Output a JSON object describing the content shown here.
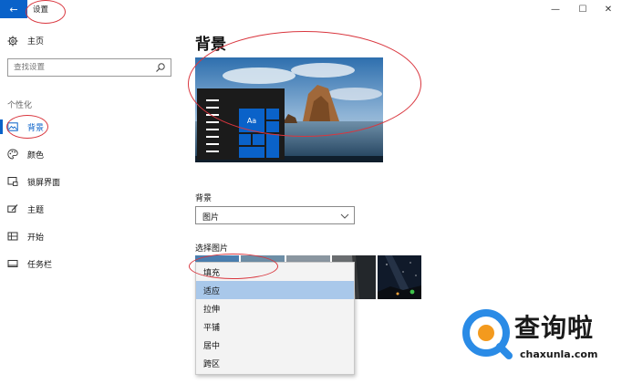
{
  "window": {
    "back_glyph": "←",
    "title": "设置",
    "controls": {
      "minimize": "—",
      "maximize": "☐",
      "close": "✕"
    }
  },
  "sidebar": {
    "home_label": "主页",
    "search_placeholder": "查找设置",
    "section_label": "个性化",
    "items": [
      {
        "label": "背景",
        "icon": "picture-icon",
        "active": true
      },
      {
        "label": "颜色",
        "icon": "palette-icon",
        "active": false
      },
      {
        "label": "锁屏界面",
        "icon": "lock-screen-icon",
        "active": false
      },
      {
        "label": "主题",
        "icon": "theme-brush-icon",
        "active": false
      },
      {
        "label": "开始",
        "icon": "start-grid-icon",
        "active": false
      },
      {
        "label": "任务栏",
        "icon": "taskbar-icon",
        "active": false
      }
    ]
  },
  "main": {
    "page_title": "背景",
    "preview_tile_text": "Aa",
    "background_label": "背景",
    "background_select_value": "图片",
    "choose_picture_label": "选择图片",
    "fit_options": [
      "填充",
      "适应",
      "拉伸",
      "平铺",
      "居中",
      "跨区"
    ],
    "fit_selected": "适应"
  },
  "watermark": {
    "cn": "查询啦",
    "en": "chaxunla.com"
  },
  "colors": {
    "accent": "#0a62c9",
    "selection": "#a9c8ea",
    "annotation": "#d9363e",
    "watermark_blue": "#2a8be6",
    "watermark_orange": "#f39a1e"
  }
}
